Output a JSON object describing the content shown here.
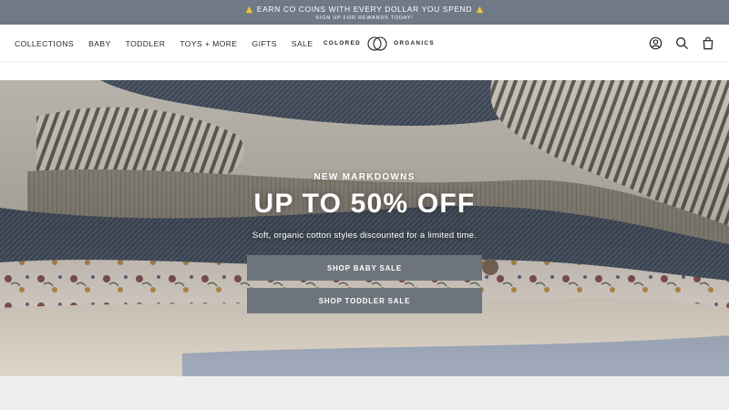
{
  "announcement": {
    "main": "EARN CO COINS WITH EVERY DOLLAR YOU SPEND",
    "sub": "SIGN UP FOR REWARDS TODAY!",
    "icon": "coin-icon",
    "background": "#707985"
  },
  "nav": {
    "items": [
      {
        "label": "COLLECTIONS"
      },
      {
        "label": "BABY"
      },
      {
        "label": "TODDLER"
      },
      {
        "label": "TOYS + MORE"
      },
      {
        "label": "GIFTS"
      },
      {
        "label": "SALE"
      }
    ]
  },
  "logo": {
    "left": "COLORED",
    "right": "ORGANICS",
    "icon": "co-logo-icon"
  },
  "header_icons": [
    "account-icon",
    "search-icon",
    "cart-icon"
  ],
  "hero": {
    "eyebrow": "NEW MARKDOWNS",
    "headline": "UP TO 50% OFF",
    "subtext": "Soft, organic cotton styles discounted for a limited time.",
    "buttons": [
      {
        "label": "SHOP BABY SALE"
      },
      {
        "label": "SHOP TODDLER SALE"
      }
    ],
    "button_color": "#6e747c"
  }
}
